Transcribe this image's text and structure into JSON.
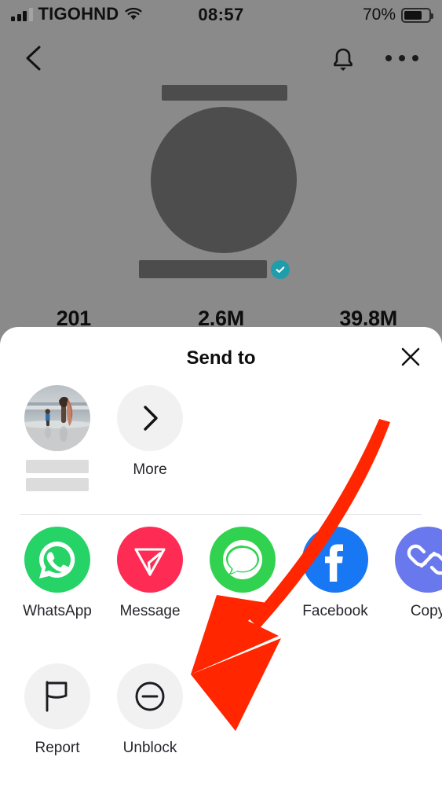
{
  "status_bar": {
    "carrier": "TIGOHND",
    "time": "08:57",
    "battery_percent": "70%",
    "signal_icon": "cellular-bars-icon",
    "wifi_icon": "wifi-icon",
    "battery_icon": "battery-icon"
  },
  "nav_bar": {
    "back_icon": "chevron-left-icon",
    "title": "",
    "bell_icon": "bell-icon",
    "more_icon": "three-dots-icon"
  },
  "profile": {
    "avatar": "redacted-avatar",
    "username": "",
    "verified_icon": "verified-check-icon",
    "stats": [
      {
        "value": "201",
        "label": ""
      },
      {
        "value": "2.6M",
        "label": ""
      },
      {
        "value": "39.8M",
        "label": ""
      }
    ]
  },
  "sheet": {
    "title": "Send to",
    "close_icon": "close-x-icon",
    "contacts": [
      {
        "name": "",
        "avatar": "beach-surfer-photo",
        "type": "contact"
      },
      {
        "label": "More",
        "icon": "chevron-right-icon",
        "type": "more"
      }
    ],
    "apps": [
      {
        "label": "WhatsApp",
        "icon": "whatsapp-icon",
        "color": "#25D366"
      },
      {
        "label": "Message",
        "icon": "tiktok-message-icon",
        "color": "#FE2C55"
      },
      {
        "label": "",
        "icon": "sms-messages-icon",
        "color": "#32D251"
      },
      {
        "label": "Facebook",
        "icon": "facebook-icon",
        "color": "#1877F2"
      },
      {
        "label": "Copy",
        "icon": "copy-link-icon",
        "color": "#6A78EE"
      }
    ],
    "actions": [
      {
        "label": "Report",
        "icon": "flag-icon",
        "color": "#F1F1F2"
      },
      {
        "label": "Unblock",
        "icon": "circle-minus-icon",
        "color": "#F1F1F2"
      }
    ]
  },
  "annotation": {
    "arrow_icon": "red-curved-arrow",
    "arrow_color": "#FF2600",
    "points_to": "Unblock"
  }
}
